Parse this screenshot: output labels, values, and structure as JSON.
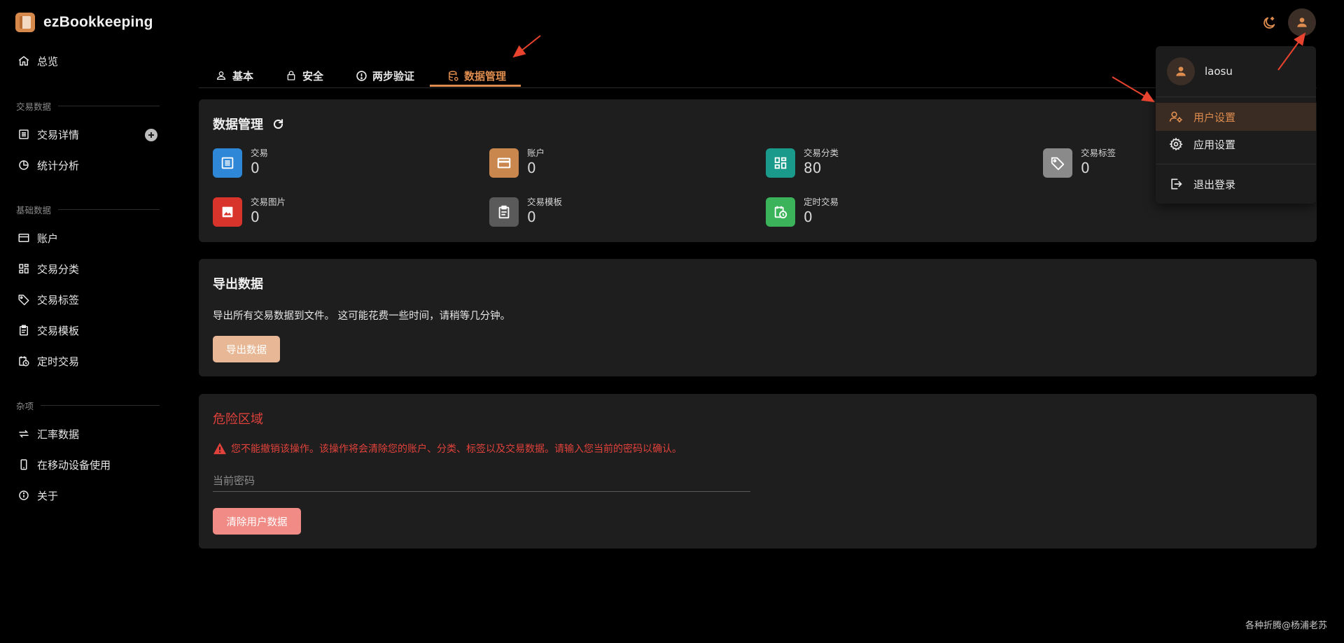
{
  "app": {
    "name": "ezBookkeeping"
  },
  "colors": {
    "accent": "#df8d4f",
    "danger": "#e0413b",
    "tile_transactions": "#2f87d8",
    "tile_accounts": "#c9874e",
    "tile_categories": "#1a9a8a",
    "tile_tags": "#8a8a8a",
    "tile_pictures": "#d9342b",
    "tile_templates": "#5a5a5a",
    "tile_scheduled": "#3bb35b"
  },
  "sidebar": {
    "overview": "总览",
    "section_transactions": "交易数据",
    "transaction_details": "交易详情",
    "statistics": "统计分析",
    "section_basic": "基础数据",
    "accounts": "账户",
    "categories": "交易分类",
    "tags": "交易标签",
    "templates": "交易模板",
    "scheduled": "定时交易",
    "section_misc": "杂项",
    "exchange_rates": "汇率数据",
    "mobile": "在移动设备使用",
    "about": "关于"
  },
  "tabs": [
    {
      "label": "基本",
      "icon": "user-icon"
    },
    {
      "label": "安全",
      "icon": "lock-icon"
    },
    {
      "label": "两步验证",
      "icon": "info-circle-icon"
    },
    {
      "label": "数据管理",
      "icon": "database-icon"
    }
  ],
  "data_management": {
    "title": "数据管理",
    "stats": [
      {
        "label": "交易",
        "value": "0",
        "icon": "list-icon"
      },
      {
        "label": "账户",
        "value": "0",
        "icon": "card-icon"
      },
      {
        "label": "交易分类",
        "value": "80",
        "icon": "grid-icon"
      },
      {
        "label": "交易标签",
        "value": "0",
        "icon": "tag-icon"
      },
      {
        "label": "交易图片",
        "value": "0",
        "icon": "image-icon"
      },
      {
        "label": "交易模板",
        "value": "0",
        "icon": "clipboard-icon"
      },
      {
        "label": "定时交易",
        "value": "0",
        "icon": "calendar-clock-icon"
      }
    ]
  },
  "export": {
    "title": "导出数据",
    "description": "导出所有交易数据到文件。 这可能花费一些时间，请稍等几分钟。",
    "button": "导出数据"
  },
  "danger": {
    "title": "危险区域",
    "warning": "您不能撤销该操作。该操作将会清除您的账户、分类、标签以及交易数据。请输入您当前的密码以确认。",
    "password_placeholder": "当前密码",
    "button": "清除用户数据"
  },
  "user_menu": {
    "username": "laosu",
    "user_settings": "用户设置",
    "app_settings": "应用设置",
    "logout": "退出登录"
  },
  "watermark": "各种折腾@杨浦老苏"
}
